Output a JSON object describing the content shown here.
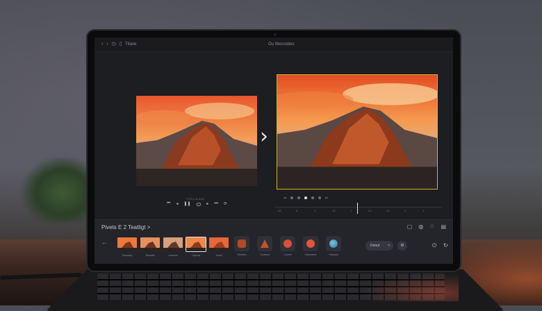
{
  "topbar": {
    "left_title": "Titane",
    "center_title": "Ou Wecosbes",
    "icons": [
      "back-icon",
      "forward-icon",
      "history-icon",
      "panel-icon"
    ]
  },
  "preview": {
    "controls_label": "CTR A ID AUD",
    "playback_icons": [
      "skip-back-icon",
      "step-back-icon",
      "pause-icon",
      "play-icon",
      "step-forward-icon",
      "skip-forward-icon",
      "loop-icon"
    ],
    "ruler_labels": [
      "48",
      "6",
      "1",
      "13",
      "1",
      "21",
      "22",
      "1",
      "4"
    ]
  },
  "panel": {
    "title": "Pivets E 2 Teatligt >",
    "right_icons": [
      "crop-icon",
      "adjust-icon",
      "filter-icon",
      "grid-icon"
    ],
    "thumbnails": [
      {
        "label": "Pasesmy",
        "kind": "photo"
      },
      {
        "label": "Reasteti",
        "kind": "photo"
      },
      {
        "label": "Lamsulo",
        "kind": "photo"
      },
      {
        "label": "Capesa",
        "kind": "photo",
        "selected": true
      },
      {
        "label": "Tuneri",
        "kind": "photo"
      },
      {
        "label": "Teselem",
        "kind": "icon"
      },
      {
        "label": "Tuceteos",
        "kind": "icon"
      },
      {
        "label": "Cuzenl",
        "kind": "icon"
      },
      {
        "label": "Oshewene",
        "kind": "icon"
      },
      {
        "label": "Tlisotune",
        "kind": "icon"
      }
    ],
    "pill_label": "Donut",
    "accent": "#c9b531"
  }
}
